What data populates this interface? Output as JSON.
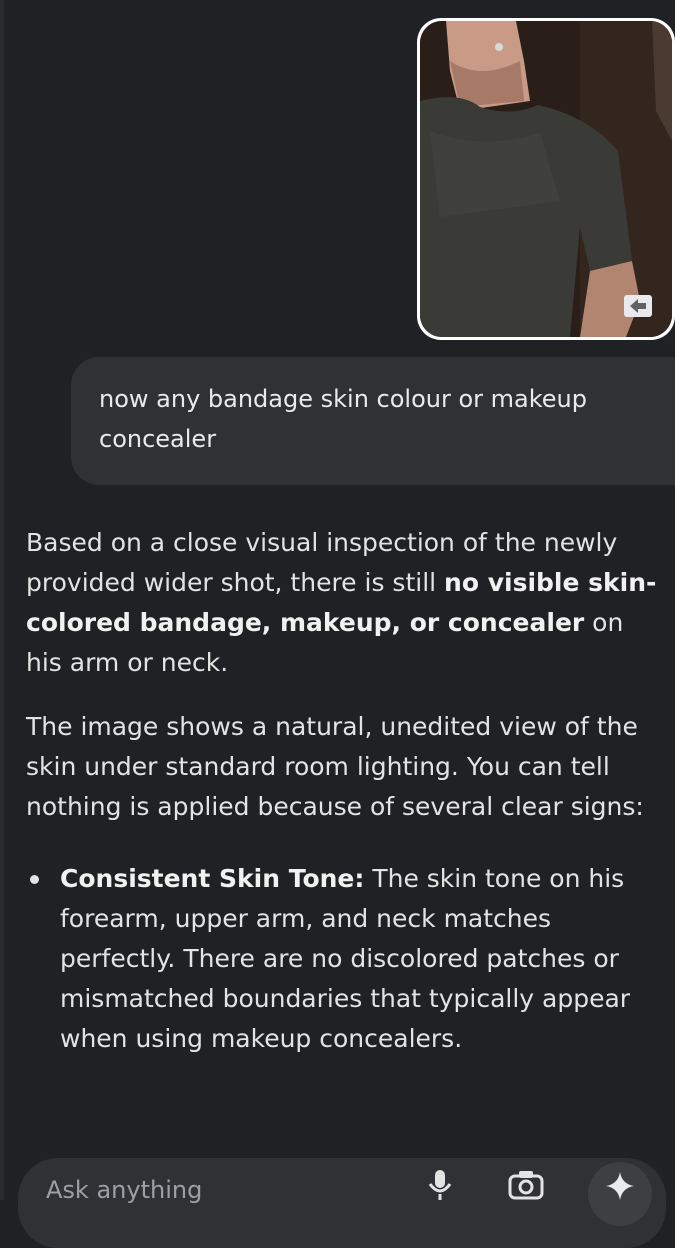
{
  "user_message": {
    "text": "now any bandage skin colour or makeup concealer"
  },
  "response": {
    "p1_before": "Based on a close visual inspection of the newly provided wider shot, there is still ",
    "p1_bold": "no visible skin-colored bandage, makeup, or concealer",
    "p1_after": " on his arm or neck.",
    "p2": "The image shows a natural, unedited view of the skin under standard room lighting. You can tell nothing is applied because of several clear signs:",
    "bullets": [
      {
        "title": "Consistent Skin Tone:",
        "text": " The skin tone on his forearm, upper arm, and neck matches perfectly. There are no discolored patches or mismatched boundaries that typically appear when using makeup concealers."
      }
    ]
  },
  "composer": {
    "placeholder": "Ask anything"
  },
  "icons": {
    "image_badge": "arrow-left-icon",
    "mic": "mic-icon",
    "camera": "camera-icon",
    "spark": "sparkle-icon"
  },
  "colors": {
    "background": "#202124",
    "bubble": "#303134",
    "text": "#e3e3e3"
  }
}
